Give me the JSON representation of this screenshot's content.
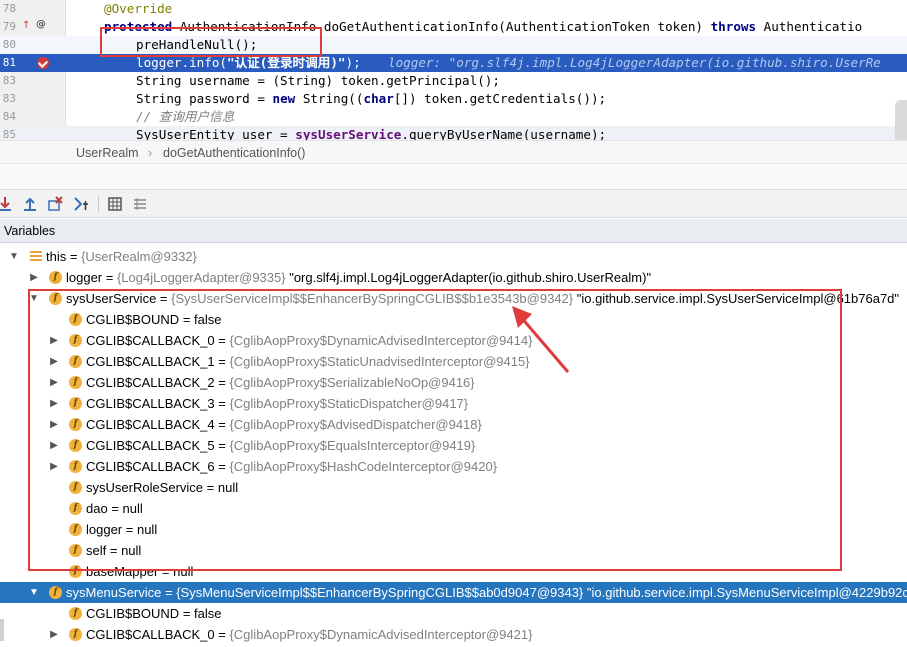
{
  "editor": {
    "lines": [
      {
        "num": "78",
        "text": "@Override"
      },
      {
        "num": "79",
        "kw": "protected",
        "text": " AuthenticationInfo doGetAuthenticationInfo(AuthenticationToken token) ",
        "kw2": "throws",
        "text2": " Authenticatio"
      },
      {
        "num": "80",
        "text": "preHandleNull();"
      },
      {
        "num": "81",
        "text": "logger.info(",
        "str": "\"认证(登录时调用)\"",
        "text2": ");",
        "inlay": "logger: \"org.slf4j.impl.Log4jLoggerAdapter(io.github.shiro.UserRe"
      },
      {
        "num": "83",
        "text": "String username = (String) token.getPrincipal();"
      },
      {
        "num": "83",
        "text": "String password = ",
        "kw": "new",
        "text2": " String((",
        "kw2": "char",
        "text3": "[]) token.getCredentials());"
      },
      {
        "num": "84",
        "text": "// 查询用户信息"
      },
      {
        "num": "85",
        "text": "SysUserEntity user = ",
        "field": "sysUserService",
        "text2": ".queryByUserName(username);"
      }
    ]
  },
  "breadcrumb": {
    "class_name": "UserRealm",
    "separator": "›",
    "method_name": "doGetAuthenticationInfo()"
  },
  "variables_panel": {
    "title": "Variables"
  },
  "tree": {
    "root": {
      "name": "this",
      "eq": " = ",
      "ref": "{UserRealm@9332}"
    },
    "logger": {
      "name": "logger",
      "eq": " = ",
      "ref": "{Log4jLoggerAdapter@9335}",
      "val": " \"org.slf4j.impl.Log4jLoggerAdapter(io.github.shiro.UserRealm)\""
    },
    "sysUserService": {
      "name": "sysUserService",
      "eq": " = ",
      "ref": "{SysUserServiceImpl$$EnhancerBySpringCGLIB$$b1e3543b@9342}",
      "val": " \"io.github.service.impl.SysUserServiceImpl@61b76a7d\""
    },
    "children": [
      {
        "name": "CGLIB$BOUND",
        "eq": " = ",
        "val": "false"
      },
      {
        "name": "CGLIB$CALLBACK_0",
        "eq": " = ",
        "ref": "{CglibAopProxy$DynamicAdvisedInterceptor@9414}"
      },
      {
        "name": "CGLIB$CALLBACK_1",
        "eq": " = ",
        "ref": "{CglibAopProxy$StaticUnadvisedInterceptor@9415}"
      },
      {
        "name": "CGLIB$CALLBACK_2",
        "eq": " = ",
        "ref": "{CglibAopProxy$SerializableNoOp@9416}"
      },
      {
        "name": "CGLIB$CALLBACK_3",
        "eq": " = ",
        "ref": "{CglibAopProxy$StaticDispatcher@9417}"
      },
      {
        "name": "CGLIB$CALLBACK_4",
        "eq": " = ",
        "ref": "{CglibAopProxy$AdvisedDispatcher@9418}"
      },
      {
        "name": "CGLIB$CALLBACK_5",
        "eq": " = ",
        "ref": "{CglibAopProxy$EqualsInterceptor@9419}"
      },
      {
        "name": "CGLIB$CALLBACK_6",
        "eq": " = ",
        "ref": "{CglibAopProxy$HashCodeInterceptor@9420}"
      },
      {
        "name": "sysUserRoleService",
        "eq": " = ",
        "val": "null"
      },
      {
        "name": "dao",
        "eq": " = ",
        "val": "null"
      },
      {
        "name": "logger",
        "eq": " = ",
        "val": "null"
      },
      {
        "name": "self",
        "eq": " = ",
        "val": "null"
      },
      {
        "name": "baseMapper",
        "eq": " = ",
        "val": "null"
      }
    ],
    "sysMenuService": {
      "name": "sysMenuService",
      "eq": " = ",
      "ref": "{SysMenuServiceImpl$$EnhancerBySpringCGLIB$$ab0d9047@9343}",
      "val": " \"io.github.service.impl.SysMenuServiceImpl@4229b92c\""
    },
    "menu_children": [
      {
        "name": "CGLIB$BOUND",
        "eq": " = ",
        "val": "false"
      },
      {
        "name": "CGLIB$CALLBACK_0",
        "eq": " = ",
        "ref": "{CglibAopProxy$DynamicAdvisedInterceptor@9421}"
      }
    ]
  },
  "colors": {
    "highlight_red": "#e03c3c",
    "selection_blue": "#2675bf",
    "exec_line_blue": "#2a5cbf",
    "field_icon": "#f0b23b"
  }
}
